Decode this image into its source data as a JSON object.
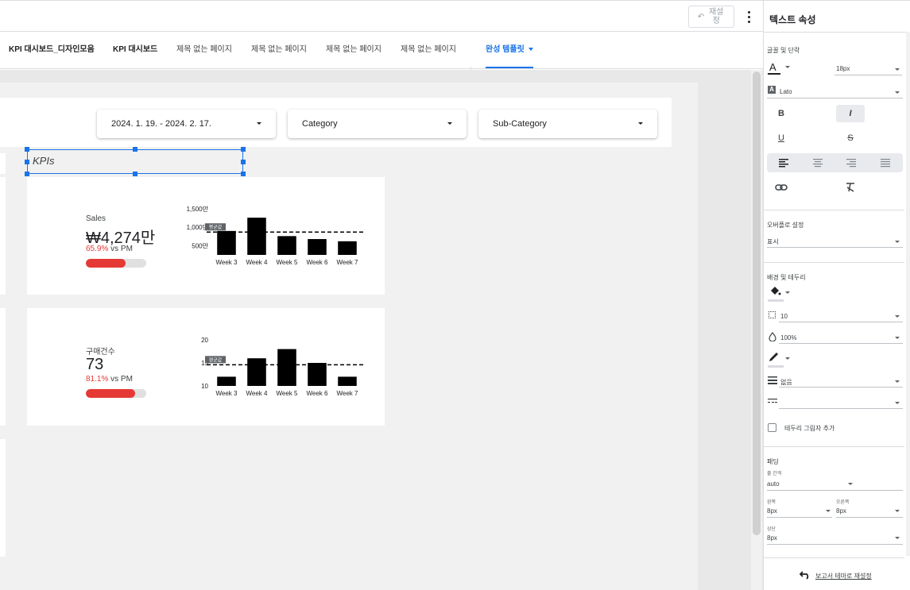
{
  "toolbar": {
    "reset_label": "재설정",
    "more_icon": "more-vert-icon"
  },
  "tabs": [
    {
      "label": "KPI 대시보드_디자인모음"
    },
    {
      "label": "KPI 대시보드"
    },
    {
      "label": "제목 없는 페이지"
    },
    {
      "label": "제목 없는 페이지"
    },
    {
      "label": "제목 없는 페이지"
    },
    {
      "label": "제목 없는 페이지"
    },
    {
      "label": "완성 템플릿"
    }
  ],
  "filters": {
    "date": "2024. 1. 19. - 2024. 2. 17.",
    "category": "Category",
    "subcategory": "Sub-Category"
  },
  "kpis_title": "KPIs",
  "cards": [
    {
      "label": "Sales",
      "value": "₩4,274만",
      "pct": "65.9%",
      "pct_suffix": " vs PM",
      "progress": 0.659,
      "chart": {
        "type": "bar",
        "categories": [
          "Week 3",
          "Week 4",
          "Week 5",
          "Week 6",
          "Week 7"
        ],
        "values": [
          900,
          1260,
          760,
          680,
          620
        ],
        "ticks": [
          "1,500만",
          "1,000만",
          "500만"
        ],
        "tick_values": [
          1500,
          1000,
          500
        ],
        "ylim": [
          250,
          1500
        ],
        "avg": 870,
        "avg_label": "평균값"
      }
    },
    {
      "label": "구매건수",
      "value": "73",
      "pct": "81.1%",
      "pct_suffix": " vs PM",
      "progress": 0.811,
      "chart": {
        "type": "bar",
        "categories": [
          "Week 3",
          "Week 4",
          "Week 5",
          "Week 6",
          "Week 7"
        ],
        "values": [
          12,
          16,
          18,
          15,
          12
        ],
        "ticks": [
          "20",
          "15",
          "10"
        ],
        "tick_values": [
          20,
          15,
          10
        ],
        "ylim": [
          10,
          20
        ],
        "avg": 14.6,
        "avg_label": "평균값"
      }
    }
  ],
  "chart_data": [
    {
      "type": "bar",
      "categories": [
        "Week 3",
        "Week 4",
        "Week 5",
        "Week 6",
        "Week 7"
      ],
      "values": [
        900,
        1260,
        760,
        680,
        620
      ],
      "ylim": [
        250,
        1500
      ],
      "avg": 870
    },
    {
      "type": "bar",
      "categories": [
        "Week 3",
        "Week 4",
        "Week 5",
        "Week 6",
        "Week 7"
      ],
      "values": [
        12,
        16,
        18,
        15,
        12
      ],
      "ylim": [
        10,
        20
      ],
      "avg": 14.6
    }
  ],
  "panel": {
    "title": "텍스트 속성",
    "font_section": "글꼴 및 단락",
    "font_size": "18px",
    "font_family": "Lato",
    "bold": "B",
    "italic": "I",
    "underline": "U",
    "strike": "S",
    "overflow_section": "오버플로 설정",
    "overflow_value": "표시",
    "bg_section": "배경 및 테두리",
    "radius_value": "10",
    "opacity_value": "100%",
    "border_weight_value": "없음",
    "shadow_label": "테두리 그림자 추가",
    "padding_section": "패딩",
    "line_spacing_label": "줄 간격",
    "line_spacing_value": "auto",
    "left_label": "왼쪽",
    "left_value": "8px",
    "right_label": "오른쪽",
    "right_value": "8px",
    "top_label": "상단",
    "top_value": "8px",
    "reset_theme": "보고서 테마로 재설정"
  }
}
